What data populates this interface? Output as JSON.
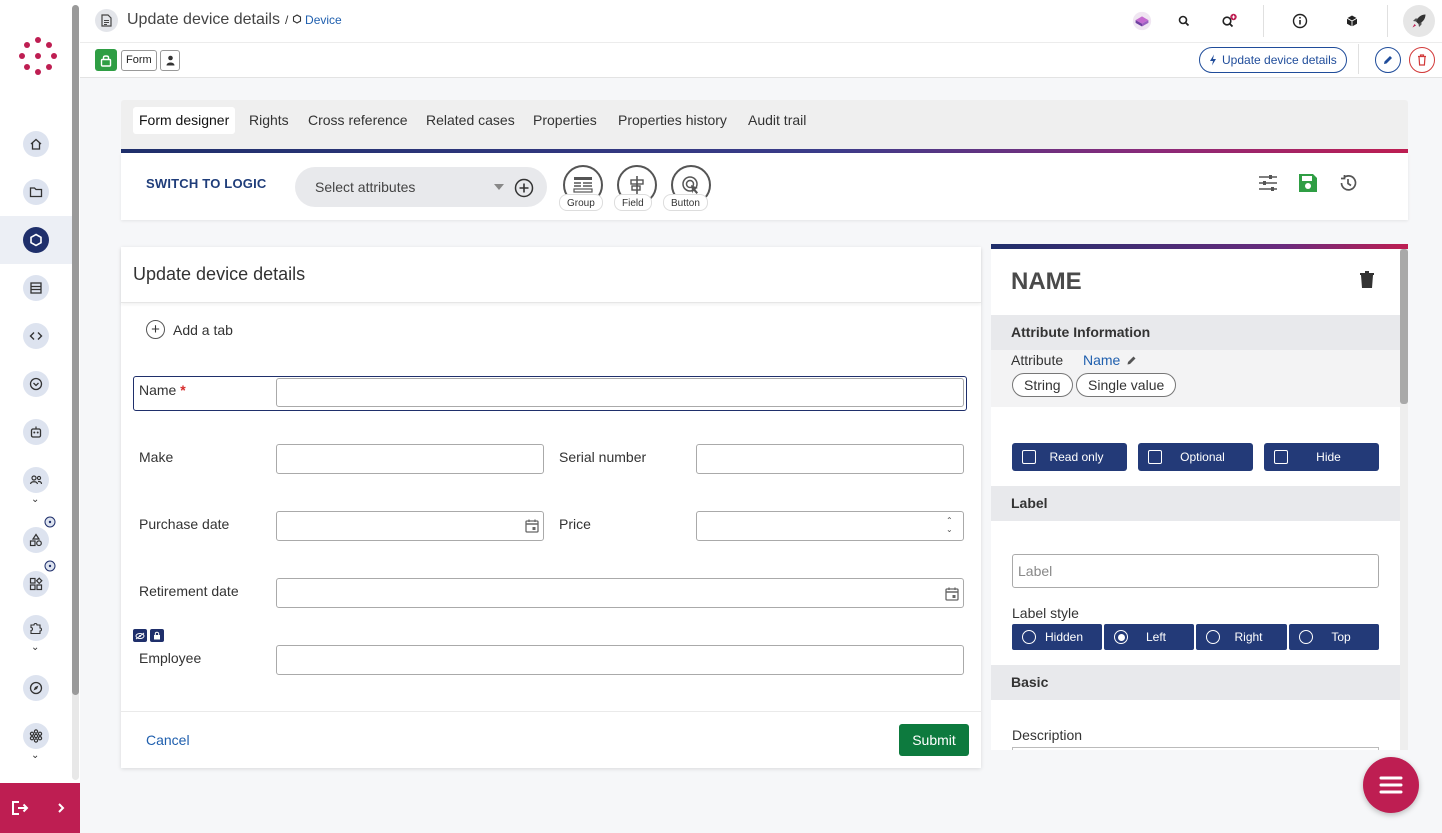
{
  "header": {
    "title": "Update device details",
    "breadcrumb_sep": "/",
    "breadcrumb_link": "Device",
    "form_chip": "Form",
    "update_button": "Update device details"
  },
  "tabs": [
    "Form designer",
    "Rights",
    "Cross reference",
    "Related cases",
    "Properties",
    "Properties history",
    "Audit trail"
  ],
  "toolbar": {
    "switch_logic": "SWITCH TO LOGIC",
    "select_placeholder": "Select attributes",
    "tools": [
      "Group",
      "Field",
      "Button"
    ]
  },
  "form": {
    "title": "Update device details",
    "add_tab": "Add a tab",
    "required_mark": "*",
    "fields": {
      "name": "Name",
      "make": "Make",
      "serial": "Serial number",
      "purchase_date": "Purchase date",
      "price": "Price",
      "retirement_date": "Retirement date",
      "employee": "Employee"
    },
    "cancel": "Cancel",
    "submit": "Submit"
  },
  "panel": {
    "title": "NAME",
    "attr_info": "Attribute Information",
    "attr_label": "Attribute",
    "attr_name": "Name",
    "pills": [
      "String",
      "Single value"
    ],
    "checks": [
      "Read only",
      "Optional",
      "Hide"
    ],
    "label_section": "Label",
    "label_placeholder": "Label",
    "label_style": "Label style",
    "label_options": [
      "Hidden",
      "Left",
      "Right",
      "Top"
    ],
    "label_selected": "Left",
    "basic_section": "Basic",
    "description": "Description"
  },
  "sidebar": {
    "icons": [
      "home-icon",
      "folder-icon",
      "hexagon-icon",
      "list-icon",
      "code-icon",
      "chevron-circle-icon",
      "robot-icon",
      "users-icon",
      "shapes-icon",
      "widgets-icon",
      "puzzle-icon",
      "compass-icon",
      "network-icon"
    ]
  },
  "colors": {
    "brand": "#be1e52",
    "navy": "#1f2f6b",
    "submit": "#0d7a3e"
  }
}
